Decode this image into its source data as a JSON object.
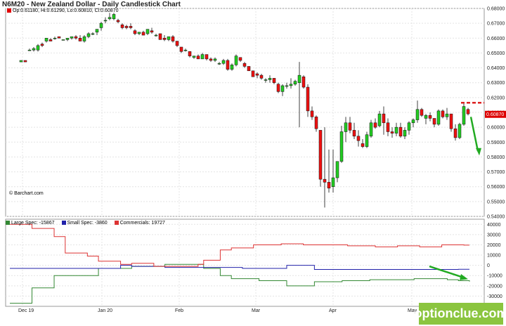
{
  "header": {
    "title": "N6M20 - New Zealand Dollar - Daily Candlestick Chart",
    "ohlc": "Op:0.61180, Hi:0.61290, Lo:0.60810, Cl:0.60870",
    "copyright": "© Barchart.com"
  },
  "watermark": "optionclue.com",
  "colors": {
    "up": "#22cc22",
    "down": "#ee1111",
    "large": "#338833",
    "small": "#2222aa",
    "commercial": "#dd3333",
    "last_price_bg": "#dd0000",
    "arrow": "#22aa22"
  },
  "chart_data": [
    {
      "type": "candlestick",
      "y_ticks": [
        "0.68000",
        "0.67000",
        "0.66000",
        "0.65000",
        "0.64000",
        "0.63000",
        "0.62000",
        "0.61000",
        "0.60000",
        "0.59000",
        "0.58000",
        "0.57000",
        "0.56000",
        "0.55000",
        "0.54000"
      ],
      "ylim": [
        0.54,
        0.68
      ],
      "last_price": "0.60870",
      "x_ticks": [
        "Dec 19",
        "Jan 20",
        "Feb",
        "Mar",
        "Apr",
        "May"
      ],
      "candles": [
        [
          0.644,
          0.645,
          0.644,
          0.645
        ],
        [
          0.645,
          0.645,
          0.644,
          0.644
        ],
        [
          0.652,
          0.653,
          0.652,
          0.652
        ],
        [
          0.652,
          0.654,
          0.651,
          0.653
        ],
        [
          0.652,
          0.656,
          0.651,
          0.655
        ],
        [
          0.656,
          0.657,
          0.654,
          0.655
        ],
        [
          0.658,
          0.66,
          0.657,
          0.66
        ],
        [
          0.659,
          0.66,
          0.658,
          0.658
        ],
        [
          0.66,
          0.661,
          0.659,
          0.66
        ],
        [
          0.661,
          0.661,
          0.66,
          0.66
        ],
        [
          0.659,
          0.659,
          0.659,
          0.659
        ],
        [
          0.659,
          0.66,
          0.658,
          0.66
        ],
        [
          0.66,
          0.661,
          0.659,
          0.661
        ],
        [
          0.661,
          0.662,
          0.659,
          0.66
        ],
        [
          0.66,
          0.662,
          0.658,
          0.658
        ],
        [
          0.658,
          0.662,
          0.657,
          0.661
        ],
        [
          0.661,
          0.664,
          0.66,
          0.663
        ],
        [
          0.663,
          0.664,
          0.662,
          0.663
        ],
        [
          0.664,
          0.666,
          0.662,
          0.666
        ],
        [
          0.667,
          0.671,
          0.665,
          0.67
        ],
        [
          0.672,
          0.674,
          0.67,
          0.672
        ],
        [
          0.673,
          0.677,
          0.672,
          0.674
        ],
        [
          0.673,
          0.677,
          0.672,
          0.676
        ],
        [
          0.672,
          0.673,
          0.67,
          0.671
        ],
        [
          0.669,
          0.67,
          0.666,
          0.667
        ],
        [
          0.668,
          0.669,
          0.666,
          0.667
        ],
        [
          0.668,
          0.67,
          0.666,
          0.667
        ],
        [
          0.665,
          0.666,
          0.662,
          0.663
        ],
        [
          0.663,
          0.664,
          0.662,
          0.664
        ],
        [
          0.664,
          0.665,
          0.662,
          0.662
        ],
        [
          0.663,
          0.666,
          0.662,
          0.666
        ],
        [
          0.665,
          0.667,
          0.663,
          0.664
        ],
        [
          0.662,
          0.663,
          0.661,
          0.662
        ],
        [
          0.663,
          0.663,
          0.659,
          0.659
        ],
        [
          0.66,
          0.662,
          0.658,
          0.659
        ],
        [
          0.659,
          0.661,
          0.658,
          0.661
        ],
        [
          0.661,
          0.662,
          0.657,
          0.658
        ],
        [
          0.658,
          0.658,
          0.654,
          0.655
        ],
        [
          0.654,
          0.654,
          0.65,
          0.651
        ],
        [
          0.652,
          0.653,
          0.651,
          0.652
        ],
        [
          0.651,
          0.651,
          0.647,
          0.648
        ],
        [
          0.647,
          0.648,
          0.646,
          0.648
        ],
        [
          0.648,
          0.649,
          0.646,
          0.646
        ],
        [
          0.646,
          0.65,
          0.646,
          0.649
        ],
        [
          0.649,
          0.649,
          0.645,
          0.646
        ],
        [
          0.646,
          0.647,
          0.644,
          0.645
        ],
        [
          0.645,
          0.647,
          0.644,
          0.646
        ],
        [
          0.643,
          0.644,
          0.642,
          0.643
        ],
        [
          0.643,
          0.646,
          0.642,
          0.645
        ],
        [
          0.645,
          0.646,
          0.638,
          0.639
        ],
        [
          0.639,
          0.643,
          0.638,
          0.642
        ],
        [
          0.642,
          0.649,
          0.641,
          0.648
        ],
        [
          0.647,
          0.647,
          0.644,
          0.645
        ],
        [
          0.643,
          0.644,
          0.64,
          0.641
        ],
        [
          0.641,
          0.641,
          0.638,
          0.638
        ],
        [
          0.638,
          0.638,
          0.634,
          0.634
        ],
        [
          0.636,
          0.637,
          0.633,
          0.635
        ],
        [
          0.635,
          0.636,
          0.632,
          0.633
        ],
        [
          0.632,
          0.633,
          0.63,
          0.632
        ],
        [
          0.632,
          0.635,
          0.63,
          0.633
        ],
        [
          0.633,
          0.633,
          0.629,
          0.63
        ],
        [
          0.629,
          0.63,
          0.623,
          0.624
        ],
        [
          0.624,
          0.629,
          0.621,
          0.628
        ],
        [
          0.628,
          0.63,
          0.626,
          0.628
        ],
        [
          0.628,
          0.633,
          0.626,
          0.629
        ],
        [
          0.629,
          0.632,
          0.628,
          0.631
        ],
        [
          0.63,
          0.644,
          0.6,
          0.635
        ],
        [
          0.634,
          0.635,
          0.626,
          0.627
        ],
        [
          0.627,
          0.629,
          0.607,
          0.611
        ],
        [
          0.611,
          0.614,
          0.605,
          0.607
        ],
        [
          0.607,
          0.608,
          0.597,
          0.599
        ],
        [
          0.598,
          0.598,
          0.56,
          0.565
        ],
        [
          0.565,
          0.6,
          0.546,
          0.563
        ],
        [
          0.563,
          0.585,
          0.556,
          0.559
        ],
        [
          0.56,
          0.585,
          0.556,
          0.566
        ],
        [
          0.566,
          0.577,
          0.563,
          0.577
        ],
        [
          0.577,
          0.601,
          0.576,
          0.597
        ],
        [
          0.597,
          0.607,
          0.59,
          0.603
        ],
        [
          0.603,
          0.607,
          0.596,
          0.598
        ],
        [
          0.598,
          0.603,
          0.592,
          0.594
        ],
        [
          0.594,
          0.598,
          0.587,
          0.591
        ],
        [
          0.589,
          0.592,
          0.586,
          0.587
        ],
        [
          0.587,
          0.597,
          0.586,
          0.595
        ],
        [
          0.594,
          0.605,
          0.593,
          0.603
        ],
        [
          0.603,
          0.606,
          0.599,
          0.6
        ],
        [
          0.601,
          0.611,
          0.6,
          0.609
        ],
        [
          0.609,
          0.614,
          0.595,
          0.603
        ],
        [
          0.603,
          0.606,
          0.594,
          0.597
        ],
        [
          0.597,
          0.6,
          0.593,
          0.596
        ],
        [
          0.596,
          0.603,
          0.594,
          0.6
        ],
        [
          0.6,
          0.603,
          0.593,
          0.594
        ],
        [
          0.594,
          0.6,
          0.592,
          0.598
        ],
        [
          0.598,
          0.604,
          0.595,
          0.603
        ],
        [
          0.603,
          0.606,
          0.6,
          0.605
        ],
        [
          0.605,
          0.618,
          0.603,
          0.612
        ],
        [
          0.612,
          0.613,
          0.607,
          0.608
        ],
        [
          0.606,
          0.609,
          0.602,
          0.608
        ],
        [
          0.608,
          0.61,
          0.604,
          0.606
        ],
        [
          0.606,
          0.606,
          0.6,
          0.602
        ],
        [
          0.602,
          0.612,
          0.601,
          0.611
        ],
        [
          0.611,
          0.612,
          0.606,
          0.607
        ],
        [
          0.607,
          0.613,
          0.605,
          0.609
        ],
        [
          0.609,
          0.609,
          0.597,
          0.599
        ],
        [
          0.599,
          0.602,
          0.591,
          0.593
        ],
        [
          0.593,
          0.603,
          0.592,
          0.602
        ],
        [
          0.602,
          0.616,
          0.601,
          0.614
        ],
        [
          0.612,
          0.613,
          0.608,
          0.609
        ]
      ]
    },
    {
      "type": "line",
      "y_ticks": [
        "40000",
        "20000",
        "0",
        "-20000"
      ],
      "y_tick_labels": [
        "40000",
        "30000",
        "20000",
        "10000",
        "0",
        "-10000",
        "-20000",
        "-30000"
      ],
      "ylim": [
        -40000,
        45000
      ],
      "series": [
        {
          "name": "Large Spec: -15867",
          "color": "#338833",
          "values": [
            -37000,
            -37000,
            -37000,
            -37000,
            -22000,
            -22000,
            -22000,
            -22000,
            -10000,
            -10000,
            -10000,
            -10000,
            -10000,
            -10000,
            -10000,
            -10000,
            -3000,
            -3000,
            -3000,
            -3000,
            -3000,
            -3000,
            -1000,
            -1000,
            -1000,
            -1000,
            -1000,
            -1000,
            1000,
            1000,
            1000,
            1000,
            1000,
            1000,
            1000,
            -3000,
            -3000,
            -3000,
            -10000,
            -10000,
            -13000,
            -13000,
            -13000,
            -13000,
            -13000,
            -15000,
            -15000,
            -15000,
            -15000,
            -15000,
            -20000,
            -20000,
            -20000,
            -20000,
            -20000,
            -16000,
            -16000,
            -16000,
            -16000,
            -16000,
            -15000,
            -15000,
            -15000,
            -15000,
            -15000,
            -14000,
            -14000,
            -14000,
            -14000,
            -14000,
            -14000,
            -14000,
            -14000,
            -13000,
            -13000,
            -13000,
            -13000,
            -13000,
            -13000,
            -14000,
            -14000,
            -15000,
            -15000,
            -15867
          ]
        },
        {
          "name": "Small Spec: -3860",
          "color": "#2222aa",
          "values": [
            -3000,
            -3000,
            -3000,
            -3000,
            -3000,
            -3000,
            -3000,
            -3000,
            -3000,
            -3000,
            -3000,
            -3000,
            -3000,
            -3000,
            -3000,
            -3000,
            -3000,
            -3000,
            -3000,
            -3000,
            0,
            0,
            -1000,
            -1000,
            -1000,
            -1000,
            -1000,
            -1000,
            -2000,
            -2000,
            -2000,
            -2000,
            -2000,
            -2000,
            -2000,
            -2000,
            -2000,
            -2000,
            -2000,
            -2000,
            -2000,
            -2000,
            -3000,
            -3000,
            -3000,
            -3000,
            -3000,
            -3000,
            -3000,
            -3000,
            0,
            0,
            0,
            0,
            0,
            -4000,
            -4000,
            -4000,
            -4000,
            -4000,
            -4000,
            -4000,
            -4000,
            -4000,
            -4000,
            -4000,
            -4000,
            -4000,
            -4000,
            -4000,
            -4000,
            -4000,
            -4000,
            -4000,
            -4000,
            -4000,
            -4000,
            -4000,
            -4000,
            -4000,
            -4000,
            -3860,
            -3860,
            -3860
          ]
        },
        {
          "name": "Commercials: 19727",
          "color": "#dd3333",
          "values": [
            40000,
            40000,
            40000,
            40000,
            36000,
            36000,
            36000,
            36000,
            28000,
            28000,
            12000,
            12000,
            12000,
            12000,
            9000,
            9000,
            4000,
            4000,
            4000,
            4000,
            1000,
            1000,
            2000,
            2000,
            2000,
            2000,
            -1000,
            -1000,
            -1000,
            -1000,
            -1000,
            -1000,
            -1000,
            -1000,
            1000,
            5000,
            5000,
            5000,
            15000,
            15000,
            17000,
            17000,
            17000,
            17000,
            20000,
            20000,
            20000,
            20000,
            20000,
            21000,
            21000,
            21000,
            21000,
            20000,
            20000,
            20000,
            20000,
            20000,
            20000,
            20000,
            20000,
            19000,
            19000,
            19000,
            19000,
            19000,
            18000,
            18000,
            18000,
            18000,
            19000,
            19000,
            19000,
            19000,
            18000,
            18000,
            18000,
            18000,
            20000,
            20000,
            20000,
            20000,
            19727,
            19727
          ]
        }
      ]
    }
  ]
}
